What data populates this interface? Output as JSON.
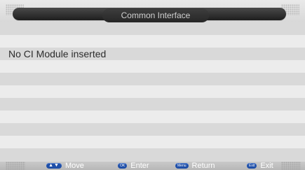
{
  "header": {
    "title": "Common Interface"
  },
  "message": "No CI Module inserted",
  "footer": {
    "hints": [
      {
        "key": "▲▼",
        "label": "Move"
      },
      {
        "key": "OK",
        "label": "Enter"
      },
      {
        "key": "Menu",
        "label": "Return"
      },
      {
        "key": "Exit",
        "label": "Exit"
      }
    ]
  },
  "colors": {
    "title_bar": "#2a2a2a",
    "key_pill": "#1f4fa8",
    "row_light": "#ececec",
    "row_dark": "#d9d9d9"
  }
}
